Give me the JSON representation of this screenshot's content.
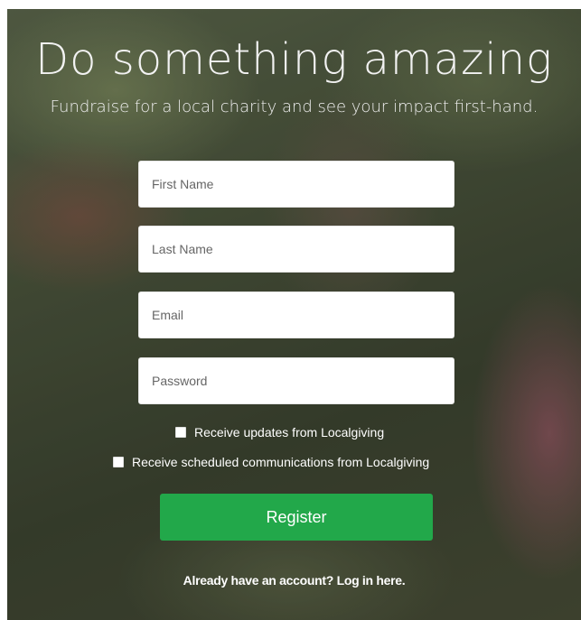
{
  "hero": {
    "title": "Do something amazing",
    "subtitle": "Fundraise for a local charity and see your impact first-hand."
  },
  "form": {
    "first_name_placeholder": "First Name",
    "last_name_placeholder": "Last Name",
    "email_placeholder": "Email",
    "password_placeholder": "Password",
    "updates_label": "Receive updates from Localgiving",
    "communications_label": "Receive scheduled communications from Localgiving",
    "register_label": "Register"
  },
  "footer": {
    "login_text": "Already have an account? Log in here."
  },
  "colors": {
    "button_green": "#22a84a"
  }
}
